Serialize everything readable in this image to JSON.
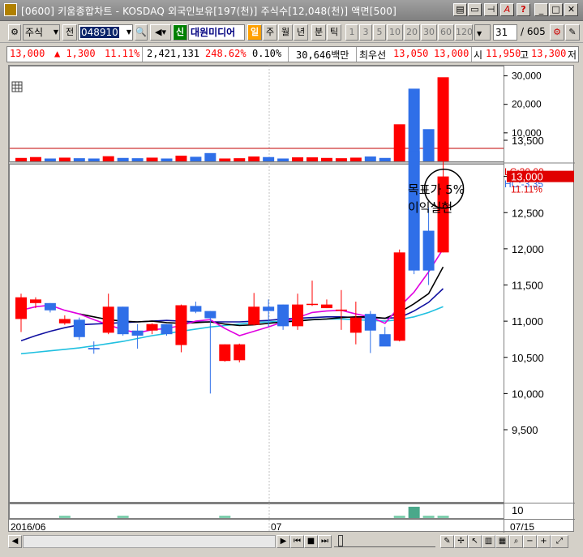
{
  "window": {
    "title": "[0600] 키움종합차트 - KOSDAQ 외국인보유[197(천)] 주식수[12,048(천)] 액면[500]"
  },
  "toolbar": {
    "market": "주식",
    "prev": "전",
    "code": "048910",
    "shin": "신",
    "stock_name": "대원미디어",
    "periods": [
      "일",
      "주",
      "월",
      "년",
      "분",
      "틱"
    ],
    "minutes": [
      "1",
      "3",
      "5",
      "10",
      "20",
      "30",
      "60",
      "120"
    ],
    "count": "31",
    "total": "/ 605"
  },
  "info": {
    "price": "13,000",
    "change": "▲ 1,300",
    "change_pct": "11.11%",
    "volume": "2,421,131",
    "volume_ratio": "248.62%",
    "turnover": "0.10%",
    "amount": "30,646백만",
    "best_label": "최우선",
    "best_bid": "13,050",
    "best_ask": "13,000",
    "open_label": "시",
    "open": "11,950",
    "high_label": "고",
    "high": "13,300",
    "low_label": "저"
  },
  "colors": {
    "up": "#ff0000",
    "down": "#2f6fe8",
    "ma5": "#e000e0",
    "ma10": "#000000",
    "ma20": "#1010a0",
    "ma60": "#20c0e0"
  },
  "chart_data": {
    "type": "candlestick",
    "price_axis": {
      "ticks": [
        "13,500",
        "13,000",
        "12,500",
        "12,000",
        "11,500",
        "11,000",
        "10,500",
        "10,000",
        "9,500"
      ],
      "ylim": [
        9400,
        13900
      ]
    },
    "volume_axis": {
      "ticks": [
        "30,000",
        "20,000",
        "10,000"
      ],
      "ylim": [
        0,
        33000
      ]
    },
    "lc_label": "LC:30,00",
    "hc_label": "HC:-3,35",
    "current_price_label": "13,000",
    "current_pct_label": "11.11%",
    "annotation": [
      "목표가 5%",
      "이익실현"
    ],
    "x_labels": [
      "2016/06",
      "07",
      "07/15"
    ],
    "bottom_value": "10",
    "candles": [
      {
        "o": 11030,
        "h": 11380,
        "l": 10850,
        "c": 11330
      },
      {
        "o": 11250,
        "h": 11330,
        "l": 11180,
        "c": 11300
      },
      {
        "o": 11250,
        "h": 11250,
        "l": 11120,
        "c": 11150
      },
      {
        "o": 10970,
        "h": 11080,
        "l": 10950,
        "c": 11030
      },
      {
        "o": 11020,
        "h": 11050,
        "l": 10740,
        "c": 10780
      },
      {
        "o": 10630,
        "h": 10720,
        "l": 10550,
        "c": 10610
      },
      {
        "o": 10840,
        "h": 11380,
        "l": 10820,
        "c": 11200
      },
      {
        "o": 11200,
        "h": 11200,
        "l": 10800,
        "c": 10820
      },
      {
        "o": 10870,
        "h": 10960,
        "l": 10620,
        "c": 10800
      },
      {
        "o": 10870,
        "h": 10970,
        "l": 10820,
        "c": 10960
      },
      {
        "o": 10960,
        "h": 10960,
        "l": 10800,
        "c": 10820
      },
      {
        "o": 10670,
        "h": 11230,
        "l": 10570,
        "c": 11220
      },
      {
        "o": 11210,
        "h": 11270,
        "l": 11110,
        "c": 11130
      },
      {
        "o": 11140,
        "h": 11140,
        "l": 10000,
        "c": 11040
      },
      {
        "o": 10450,
        "h": 10680,
        "l": 10440,
        "c": 10680
      },
      {
        "o": 10460,
        "h": 10690,
        "l": 10430,
        "c": 10680
      },
      {
        "o": 10950,
        "h": 11390,
        "l": 10940,
        "c": 11200
      },
      {
        "o": 11200,
        "h": 11300,
        "l": 10920,
        "c": 11140
      },
      {
        "o": 11230,
        "h": 11230,
        "l": 10880,
        "c": 10930
      },
      {
        "o": 10930,
        "h": 11380,
        "l": 10880,
        "c": 11230
      },
      {
        "o": 11230,
        "h": 11560,
        "l": 11210,
        "c": 11240
      },
      {
        "o": 11180,
        "h": 11300,
        "l": 11180,
        "c": 11230
      },
      {
        "o": 11160,
        "h": 11430,
        "l": 10880,
        "c": 11160
      },
      {
        "o": 10840,
        "h": 11270,
        "l": 10680,
        "c": 11050
      },
      {
        "o": 11100,
        "h": 11140,
        "l": 10560,
        "c": 10870
      },
      {
        "o": 10820,
        "h": 10920,
        "l": 10670,
        "c": 10650
      },
      {
        "o": 10730,
        "h": 11990,
        "l": 10720,
        "c": 11950
      },
      {
        "o": 13350,
        "h": 13450,
        "l": 11650,
        "c": 11700
      },
      {
        "o": 12250,
        "h": 12570,
        "l": 11500,
        "c": 11700
      },
      {
        "o": 11950,
        "h": 13300,
        "l": 11950,
        "c": 13000
      }
    ],
    "volumes": [
      1200,
      1500,
      1000,
      1300,
      1100,
      1000,
      1800,
      1200,
      1100,
      1300,
      1000,
      2000,
      1600,
      2900,
      1000,
      1100,
      1700,
      1500,
      1000,
      1400,
      1400,
      1200,
      1100,
      1300,
      1700,
      1200,
      13000,
      25500,
      11300,
      29500
    ],
    "ma5": [
      11150,
      11200,
      11220,
      11150,
      11100,
      11020,
      10950,
      10880,
      10840,
      10880,
      10900,
      10940,
      11000,
      11020,
      10900,
      10800,
      10860,
      10920,
      10990,
      11050,
      11120,
      11140,
      11150,
      11100,
      11060,
      10970,
      11200,
      11400,
      11680,
      12000
    ],
    "ma10": [
      null,
      null,
      null,
      null,
      11100,
      11060,
      11020,
      11000,
      10990,
      11000,
      10980,
      10970,
      10980,
      10990,
      10960,
      10940,
      10950,
      10970,
      10990,
      11000,
      11020,
      11030,
      11050,
      11060,
      11060,
      11040,
      11120,
      11240,
      11380,
      11750
    ],
    "ma20": [
      10730,
      10800,
      10860,
      10910,
      10950,
      10960,
      10970,
      10980,
      10990,
      11000,
      11010,
      11000,
      10990,
      10990,
      10990,
      10990,
      11000,
      11010,
      11030,
      11040,
      11050,
      11060,
      11060,
      11050,
      11050,
      11040,
      11050,
      11140,
      11260,
      11450
    ],
    "ma60": [
      10550,
      10570,
      10590,
      10610,
      10630,
      10660,
      10690,
      10720,
      10760,
      10800,
      10830,
      10860,
      10890,
      10920,
      10940,
      10960,
      10980,
      10990,
      11000,
      11010,
      11020,
      11030,
      11030,
      11020,
      11010,
      11000,
      11020,
      11060,
      11120,
      11200
    ]
  }
}
